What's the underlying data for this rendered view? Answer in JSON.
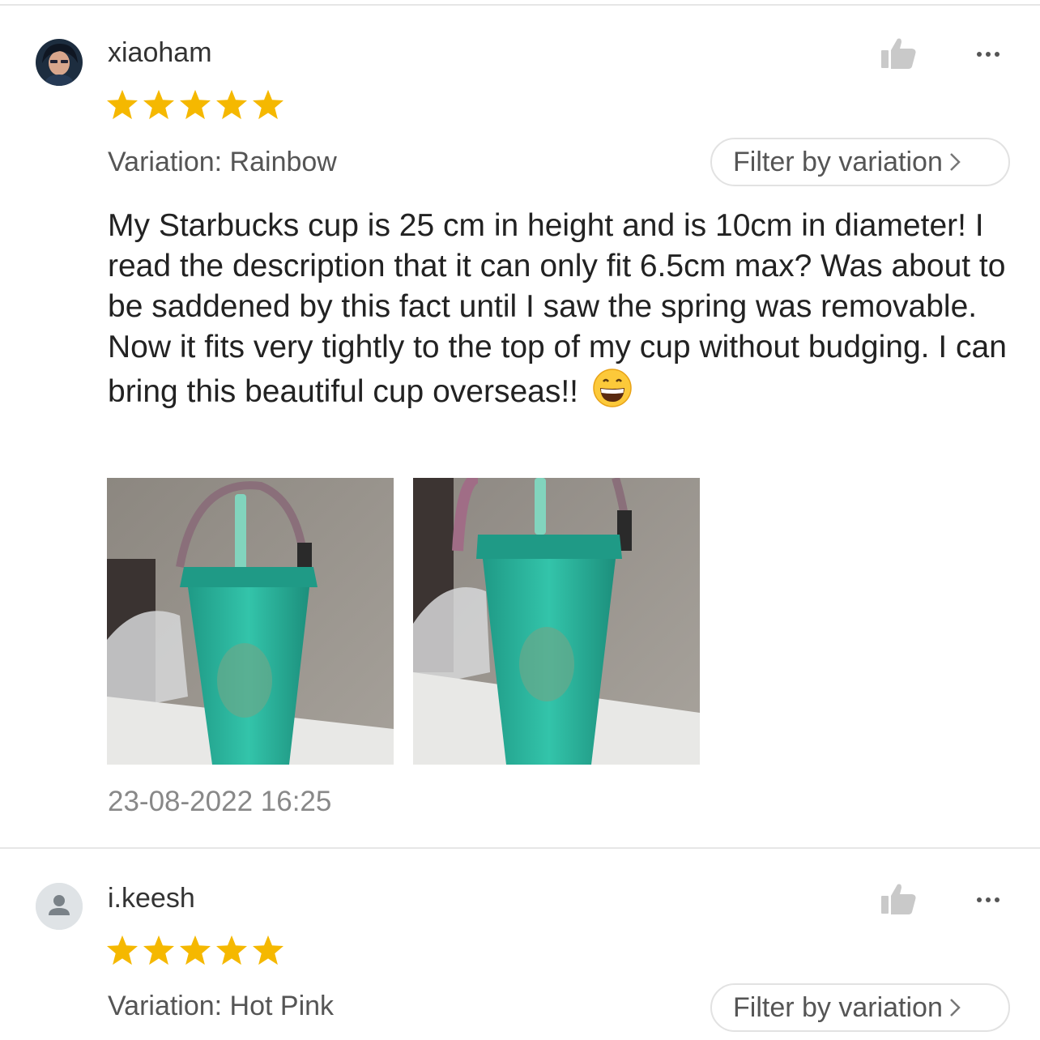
{
  "reviews": [
    {
      "username": "xiaoham",
      "rating": 5,
      "variation": "Variation: Rainbow",
      "filter_label": "Filter by variation",
      "comment": "My Starbucks cup is 25 cm in height and is 10cm in diameter! I read the description that it can only fit 6.5cm max? Was about to be saddened by this fact until I saw the spring was removable. Now it fits very tightly to the top of my cup without budging. I can bring this beautiful cup overseas!!",
      "emoji": "grinning-face-emoji",
      "photos": [
        "green-studded-cup-photo-1",
        "green-studded-cup-photo-2"
      ],
      "timestamp": "23-08-2022 16:25"
    },
    {
      "username": "i.keesh",
      "rating": 5,
      "variation": "Variation: Hot Pink",
      "filter_label": "Filter by variation"
    }
  ],
  "colors": {
    "star": "#f5b800",
    "cup": "#27b39a",
    "divider": "#e6e6e6",
    "muted_text": "#888888"
  },
  "icons": {
    "like": "thumbs-up-icon",
    "more": "more-horizontal-icon",
    "chevron": "chevron-right-icon",
    "default_avatar": "user-silhouette-icon"
  }
}
